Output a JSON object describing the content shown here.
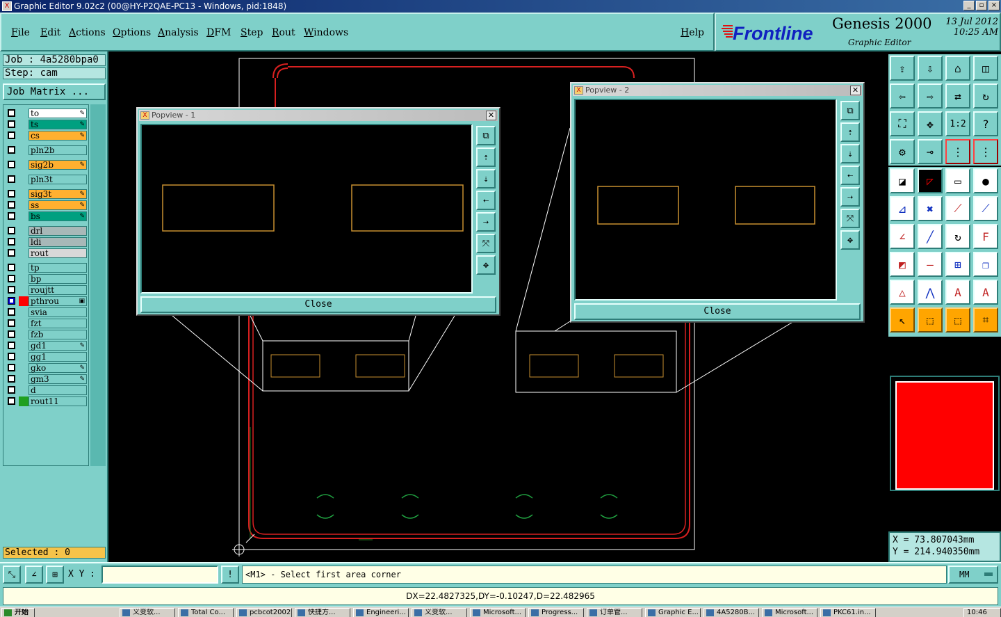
{
  "window": {
    "title": "Graphic Editor 9.02c2 (00@HY-P2QAE-PC13 - Windows, pid:1848)",
    "buttons": [
      "_",
      "▫",
      "×"
    ]
  },
  "menu": {
    "items": [
      "File",
      "Edit",
      "Actions",
      "Options",
      "Analysis",
      "DFM",
      "Step",
      "Rout",
      "Windows"
    ],
    "help": "Help"
  },
  "brand": {
    "logo": "Frontline",
    "product": "Genesis 2000",
    "subtitle": "Graphic Editor",
    "date": "13 Jul 2012",
    "time": "10:25 AM"
  },
  "left": {
    "job": "Job : 4a5280bpa0",
    "step": "Step: cam",
    "job_matrix": "Job Matrix ...",
    "selected": "Selected : 0",
    "layers": [
      {
        "name": "to",
        "color": "#ffffff",
        "mark": "✎",
        "state": "empty"
      },
      {
        "name": "ts",
        "color": "#00a080",
        "mark": "✎",
        "state": "empty"
      },
      {
        "name": "cs",
        "color": "#ffb030",
        "mark": "✎",
        "state": "empty"
      },
      {
        "name": "pln2b",
        "color": "#7fd0c9",
        "mark": "",
        "state": "empty"
      },
      {
        "name": "sig2b",
        "color": "#ffb030",
        "mark": "✎",
        "state": "empty"
      },
      {
        "name": "pln3t",
        "color": "#7fd0c9",
        "mark": "",
        "state": "empty"
      },
      {
        "name": "sig3t",
        "color": "#ffb030",
        "mark": "✎",
        "state": "empty"
      },
      {
        "name": "ss",
        "color": "#ffb030",
        "mark": "✎",
        "state": "empty"
      },
      {
        "name": "bs",
        "color": "#00a080",
        "mark": "✎",
        "state": "empty"
      },
      {
        "name": "drl",
        "color": "#a8b8b8",
        "mark": "",
        "state": "empty"
      },
      {
        "name": "ldi",
        "color": "#a8b8b8",
        "mark": "",
        "state": "empty"
      },
      {
        "name": "rout",
        "color": "#d8d8d8",
        "mark": "",
        "state": "empty"
      },
      {
        "name": "tp",
        "color": "#7fd0c9",
        "mark": "",
        "state": "empty"
      },
      {
        "name": "bp",
        "color": "#7fd0c9",
        "mark": "",
        "state": "empty"
      },
      {
        "name": "roujtt",
        "color": "#7fd0c9",
        "mark": "",
        "state": "empty"
      },
      {
        "name": "pthrou",
        "color": "#7fd0c9",
        "mark": "▣",
        "state": "selected",
        "swatch": "#ff0000"
      },
      {
        "name": "svia",
        "color": "#7fd0c9",
        "mark": "",
        "state": "empty"
      },
      {
        "name": "fzt",
        "color": "#7fd0c9",
        "mark": "",
        "state": "empty"
      },
      {
        "name": "fzb",
        "color": "#7fd0c9",
        "mark": "",
        "state": "empty"
      },
      {
        "name": "gd1",
        "color": "#7fd0c9",
        "mark": "✎",
        "state": "empty"
      },
      {
        "name": "gg1",
        "color": "#7fd0c9",
        "mark": "",
        "state": "empty"
      },
      {
        "name": "gko",
        "color": "#7fd0c9",
        "mark": "✎",
        "state": "empty"
      },
      {
        "name": "gm3",
        "color": "#7fd0c9",
        "mark": "✎",
        "state": "empty"
      },
      {
        "name": "d",
        "color": "#7fd0c9",
        "mark": "",
        "state": "empty"
      },
      {
        "name": "rout11",
        "color": "#7fd0c9",
        "mark": "",
        "state": "empty",
        "swatch": "#20a020"
      }
    ]
  },
  "popview1": {
    "title": "Popview - 1",
    "close": "Close"
  },
  "popview2": {
    "title": "Popview - 2",
    "close": "Close"
  },
  "coords": {
    "x": "X = 73.807043mm",
    "y": "Y = 214.940350mm"
  },
  "active_color": "#ff0000",
  "command": {
    "xy_label": "X Y :",
    "xy_value": "",
    "info_btn": "!",
    "prompt": "<M1> - Select first area corner",
    "units": "MM"
  },
  "status": {
    "message": "DX=22.4827325,DY=-0.10247,D=22.482965"
  },
  "taskbar": {
    "start": "开始",
    "tasks": [
      "义变软...",
      "Total Co...",
      "pcbcot2002...",
      "快捷方...",
      "Engineeri...",
      "义变软...",
      "Microsoft...",
      "Progress...",
      "订单管...",
      "Graphic E...",
      "4A5280B...",
      "Microsoft...",
      "PKC61.in..."
    ],
    "clock": "10:46"
  },
  "icons": {
    "title": "app-x-icon",
    "popview": "popview-x-icon"
  }
}
